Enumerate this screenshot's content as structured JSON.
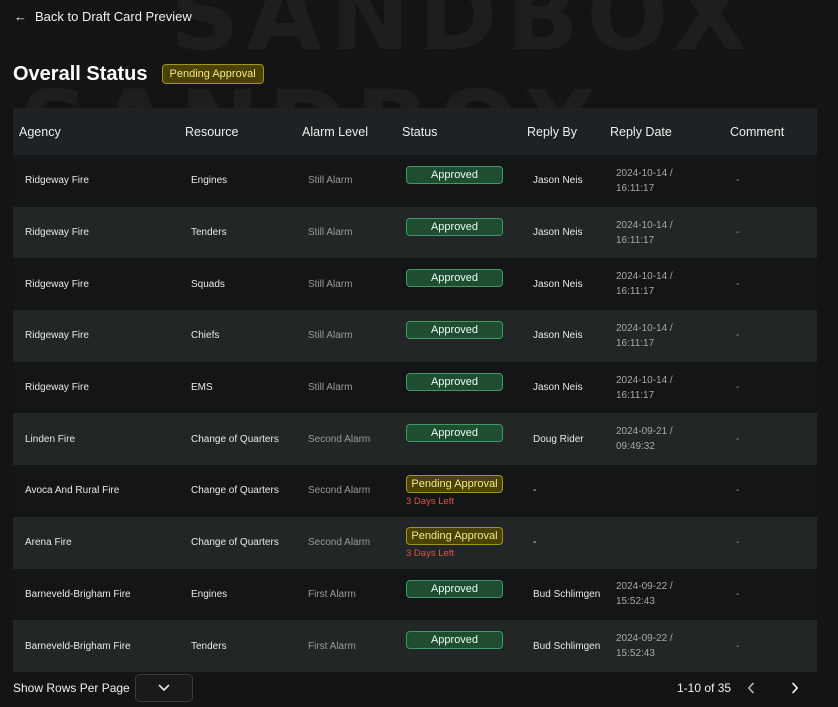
{
  "header": {
    "back_label": "Back to Draft Card Preview",
    "title": "Overall Status",
    "status_badge": "Pending Approval"
  },
  "table": {
    "columns": [
      "Agency",
      "Resource",
      "Alarm Level",
      "Status",
      "Reply By",
      "Reply Date",
      "Comment"
    ],
    "rows": [
      {
        "agency": "Ridgeway Fire",
        "resource": "Engines",
        "alarm": "Still Alarm",
        "status": "Approved",
        "status_type": "approved",
        "days_left": "",
        "reply_by": "Jason Neis",
        "date": "2024-10-14 /",
        "time": "16:11:17",
        "comment": "-"
      },
      {
        "agency": "Ridgeway Fire",
        "resource": "Tenders",
        "alarm": "Still Alarm",
        "status": "Approved",
        "status_type": "approved",
        "days_left": "",
        "reply_by": "Jason Neis",
        "date": "2024-10-14 /",
        "time": "16:11:17",
        "comment": "-"
      },
      {
        "agency": "Ridgeway Fire",
        "resource": "Squads",
        "alarm": "Still Alarm",
        "status": "Approved",
        "status_type": "approved",
        "days_left": "",
        "reply_by": "Jason Neis",
        "date": "2024-10-14 /",
        "time": "16:11:17",
        "comment": "-"
      },
      {
        "agency": "Ridgeway Fire",
        "resource": "Chiefs",
        "alarm": "Still Alarm",
        "status": "Approved",
        "status_type": "approved",
        "days_left": "",
        "reply_by": "Jason Neis",
        "date": "2024-10-14 /",
        "time": "16:11:17",
        "comment": "-"
      },
      {
        "agency": "Ridgeway Fire",
        "resource": "EMS",
        "alarm": "Still Alarm",
        "status": "Approved",
        "status_type": "approved",
        "days_left": "",
        "reply_by": "Jason Neis",
        "date": "2024-10-14 /",
        "time": "16:11:17",
        "comment": "-"
      },
      {
        "agency": "Linden Fire",
        "resource": "Change of Quarters",
        "alarm": "Second Alarm",
        "status": "Approved",
        "status_type": "approved",
        "days_left": "",
        "reply_by": "Doug Rider",
        "date": "2024-09-21 /",
        "time": "09:49:32",
        "comment": "-"
      },
      {
        "agency": "Avoca And Rural Fire",
        "resource": "Change of Quarters",
        "alarm": "Second Alarm",
        "status": "Pending Approval",
        "status_type": "pending",
        "days_left": "3 Days Left",
        "reply_by": "-",
        "date": "",
        "time": "",
        "comment": "-"
      },
      {
        "agency": "Arena Fire",
        "resource": "Change of Quarters",
        "alarm": "Second Alarm",
        "status": "Pending Approval",
        "status_type": "pending",
        "days_left": "3 Days Left",
        "reply_by": "-",
        "date": "",
        "time": "",
        "comment": "-"
      },
      {
        "agency": "Barneveld-Brigham Fire",
        "resource": "Engines",
        "alarm": "First Alarm",
        "status": "Approved",
        "status_type": "approved",
        "days_left": "",
        "reply_by": "Bud Schlimgen",
        "date": "2024-09-22 /",
        "time": "15:52:43",
        "comment": "-"
      },
      {
        "agency": "Barneveld-Brigham Fire",
        "resource": "Tenders",
        "alarm": "First Alarm",
        "status": "Approved",
        "status_type": "approved",
        "days_left": "",
        "reply_by": "Bud Schlimgen",
        "date": "2024-09-22 /",
        "time": "15:52:43",
        "comment": "-"
      }
    ]
  },
  "footer": {
    "rows_label": "Show Rows Per Page",
    "range": "1-10 of 35"
  },
  "watermark": "SANDBOX",
  "icons": {
    "back": "arrow-left-icon",
    "select": "chevron-down-icon",
    "prev": "chevron-left-icon",
    "next": "chevron-right-icon"
  },
  "colors": {
    "background": "#141414",
    "approved": "#1f4d32",
    "pending": "#4a4200",
    "days_left": "#e0533f"
  }
}
